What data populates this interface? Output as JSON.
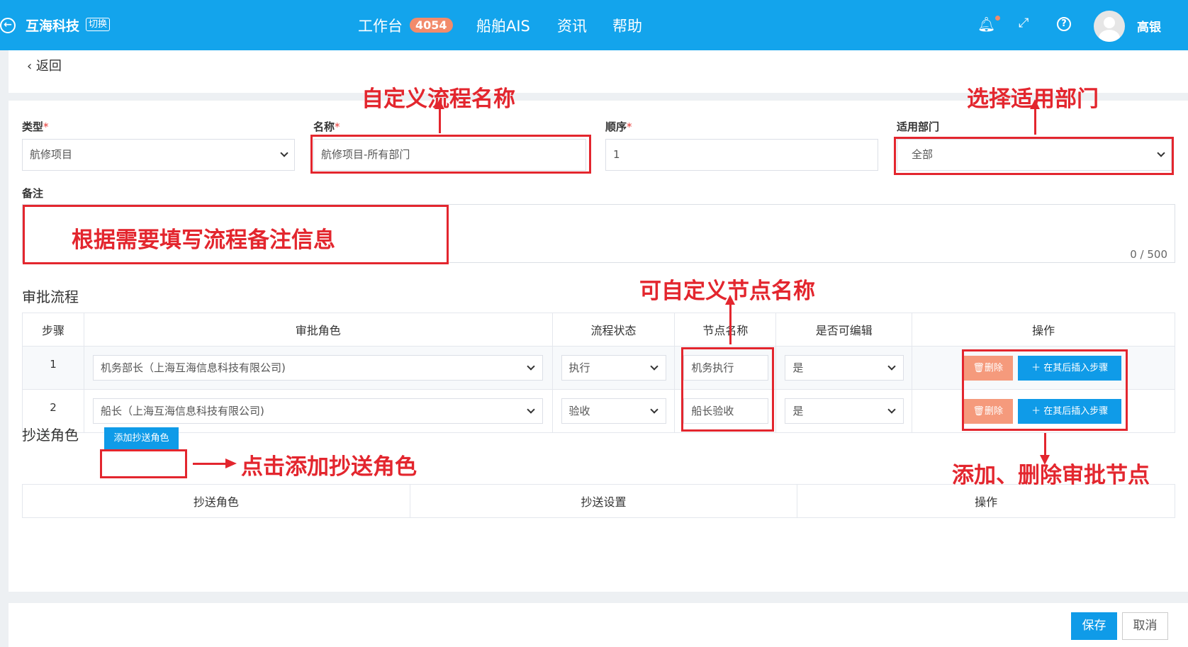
{
  "header": {
    "brand": "互海科技",
    "switch_label": "切换",
    "nav": {
      "workbench": "工作台",
      "workbench_badge": "4054",
      "ais": "船舶AIS",
      "news": "资讯",
      "help": "帮助"
    },
    "user_name": "高银",
    "icons": [
      "back-circle-icon",
      "bell-icon",
      "fullscreen-icon",
      "help-icon",
      "avatar"
    ]
  },
  "back_label": "返回",
  "form": {
    "type": {
      "label": "类型",
      "value": "航修项目"
    },
    "name": {
      "label": "名称",
      "value": "航修项目-所有部门"
    },
    "order": {
      "label": "顺序",
      "value": "1"
    },
    "dept": {
      "label": "适用部门",
      "value": "全部"
    },
    "remark": {
      "label": "备注",
      "counter": "0 / 500"
    },
    "required_mark": "*"
  },
  "approval": {
    "title": "审批流程",
    "columns": [
      "步骤",
      "审批角色",
      "流程状态",
      "节点名称",
      "是否可编辑",
      "操作"
    ],
    "rows": [
      {
        "step": "1",
        "role": "机务部长（上海互海信息科技有限公司)",
        "status": "执行",
        "node": "机务执行",
        "editable": "是"
      },
      {
        "step": "2",
        "role": "船长（上海互海信息科技有限公司)",
        "status": "验收",
        "node": "船长验收",
        "editable": "是"
      }
    ],
    "delete_label": "删除",
    "insert_label": "在其后插入步骤"
  },
  "cc": {
    "title": "抄送角色",
    "add_button": "添加抄送角色",
    "columns": [
      "抄送角色",
      "抄送设置",
      "操作"
    ]
  },
  "footer": {
    "save": "保存",
    "cancel": "取消"
  },
  "annotations": {
    "name_hint": "自定义流程名称",
    "dept_hint": "选择适用部门",
    "remark_hint": "根据需要填写流程备注信息",
    "node_hint": "可自定义节点名称",
    "cc_hint": "点击添加抄送角色",
    "ops_hint": "添加、删除审批节点",
    "color": "#e3262e"
  },
  "colors": {
    "primary": "#13a4ec",
    "danger_btn": "#f59a7c",
    "badge": "#f28b6b"
  }
}
